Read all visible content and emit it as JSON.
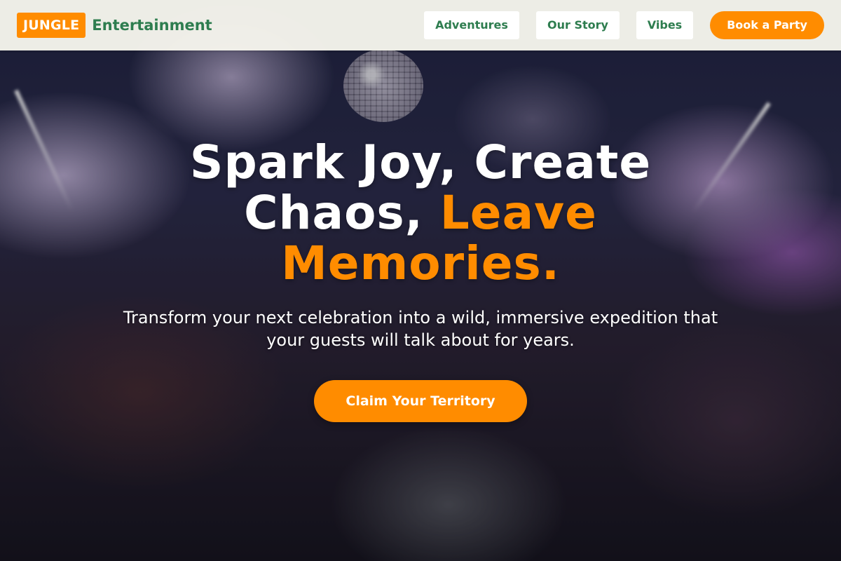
{
  "brand": {
    "badge": "JUNGLE",
    "name": "Entertainment"
  },
  "nav": {
    "items": [
      {
        "label": "Adventures"
      },
      {
        "label": "Our Story"
      },
      {
        "label": "Vibes"
      }
    ],
    "cta_label": "Book a Party"
  },
  "hero": {
    "headline_line1": "Spark Joy, Create",
    "headline_line2_white": "Chaos, ",
    "headline_line2_accent": "Leave",
    "headline_line3_accent": "Memories.",
    "subtext": "Transform your next celebration into a wild, immersive expedition that your guests will talk about for years.",
    "cta_label": "Claim Your Territory",
    "background_image": "nightclub-dj-crowd-photo"
  },
  "colors": {
    "accent": "#ff8c00",
    "brand_green": "#2e7d4f",
    "header_bg": "#f5f4ec",
    "text_light": "#ffffff"
  }
}
